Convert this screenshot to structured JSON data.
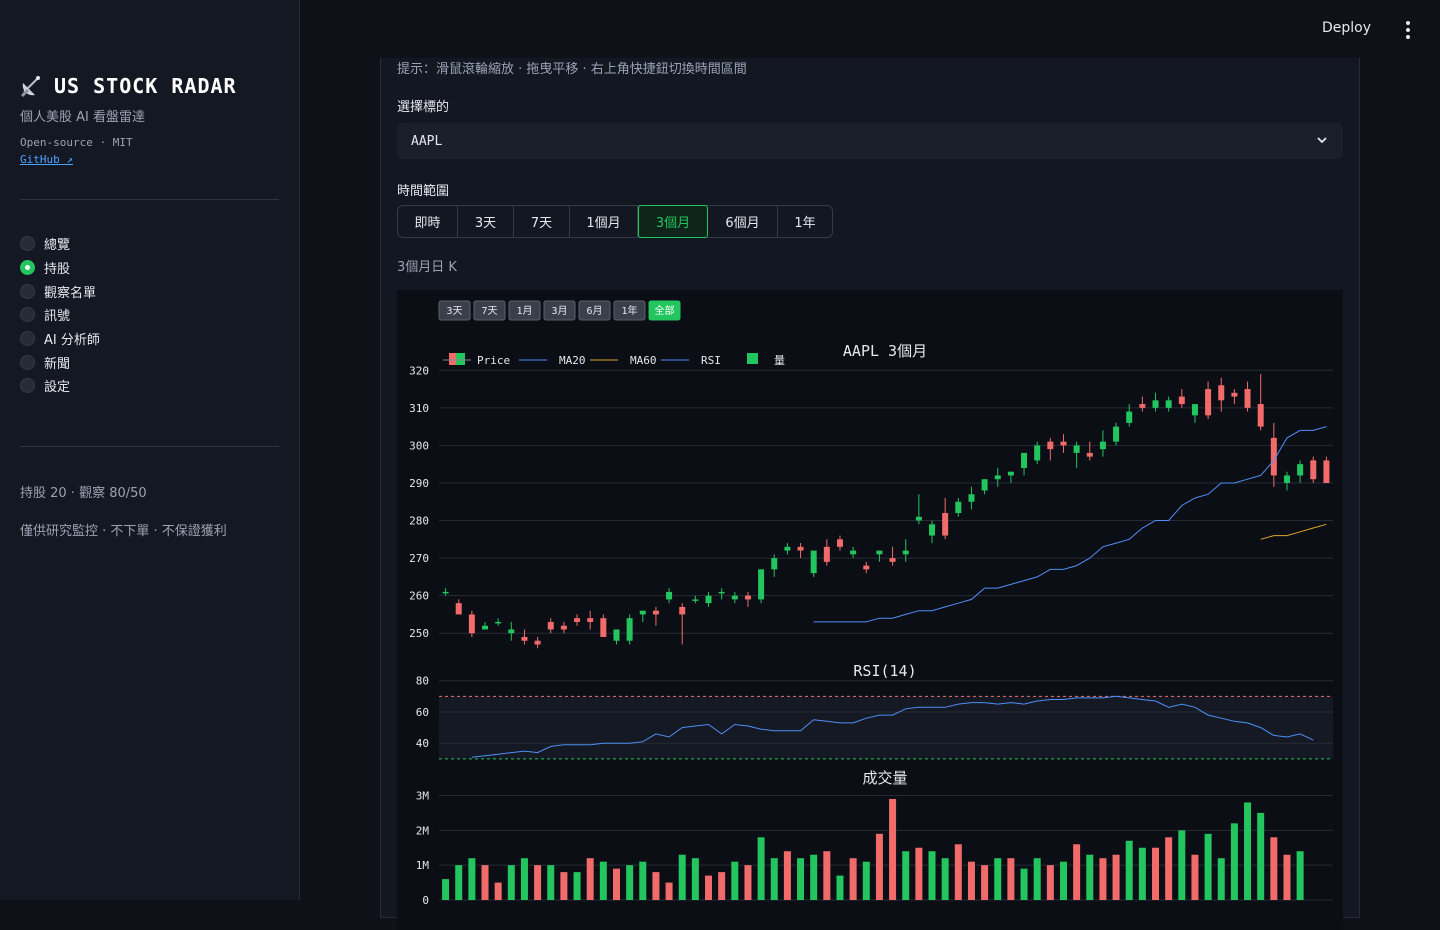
{
  "sidebar": {
    "title": "US STOCK RADAR",
    "subtitle": "個人美股 AI 看盤雷達",
    "meta": "Open-source · MIT",
    "github": "GitHub ↗",
    "nav": [
      {
        "label": "總覽",
        "selected": false
      },
      {
        "label": "持股",
        "selected": true
      },
      {
        "label": "觀察名單",
        "selected": false
      },
      {
        "label": "訊號",
        "selected": false
      },
      {
        "label": "AI 分析師",
        "selected": false
      },
      {
        "label": "新聞",
        "selected": false
      },
      {
        "label": "設定",
        "selected": false
      }
    ],
    "stats": "持股 20 · 觀察 80/50",
    "disclaimer": "僅供研究監控 · 不下單 · 不保證獲利"
  },
  "topbar": {
    "deploy": "Deploy"
  },
  "main": {
    "hint": "提示：滑鼠滾輪縮放 · 拖曳平移 · 右上角快捷鈕切換時間區間",
    "ticker_label": "選擇標的",
    "ticker_value": "AAPL",
    "range_label": "時間範圍",
    "ranges": [
      "即時",
      "3天",
      "7天",
      "1個月",
      "3個月",
      "6個月",
      "1年"
    ],
    "active_range": "3個月",
    "chart_caption": "3個月日 K"
  },
  "colors": {
    "up": "#22c55e",
    "down": "#f26b6b",
    "ma20": "#4f8ff7",
    "ma60": "#e0a526",
    "rsi": "#4f8ff7",
    "accent": "#22c55e"
  },
  "chart_data": {
    "type": "candlestick",
    "title": "AAPL 3個月",
    "rangeselector": [
      "3天",
      "7天",
      "1月",
      "3月",
      "6月",
      "1年",
      "全部"
    ],
    "rangeselector_active": "全部",
    "legend": [
      "Price",
      "MA20",
      "MA60",
      "RSI",
      "量"
    ],
    "legend_placement": "top-left",
    "price_yticks": [
      250,
      260,
      270,
      280,
      290,
      300,
      310,
      320
    ],
    "price_ylim": [
      245,
      323
    ],
    "candles": [
      [
        261,
        262,
        260,
        261
      ],
      [
        258,
        259,
        255,
        255
      ],
      [
        255,
        256,
        249,
        250
      ],
      [
        251,
        253,
        251,
        252
      ],
      [
        253,
        254,
        252,
        253
      ],
      [
        250,
        253,
        248,
        251
      ],
      [
        249,
        251,
        247,
        248
      ],
      [
        248,
        249,
        246,
        247
      ],
      [
        253,
        254,
        250,
        251
      ],
      [
        252,
        253,
        250,
        251
      ],
      [
        254,
        255,
        252,
        253
      ],
      [
        254,
        256,
        251,
        253
      ],
      [
        254,
        255,
        249,
        249
      ],
      [
        248,
        251,
        247,
        251
      ],
      [
        248,
        255,
        247,
        254
      ],
      [
        255,
        256,
        253,
        256
      ],
      [
        256,
        257,
        252,
        255
      ],
      [
        259,
        262,
        258,
        261
      ],
      [
        257,
        258,
        247,
        255
      ],
      [
        259,
        260,
        258,
        259
      ],
      [
        258,
        261,
        257,
        260
      ],
      [
        261,
        262,
        259,
        261
      ],
      [
        259,
        261,
        258,
        260
      ],
      [
        260,
        261,
        257,
        259
      ],
      [
        259,
        267,
        258,
        267
      ],
      [
        267,
        271,
        265,
        270
      ],
      [
        272,
        274,
        271,
        273
      ],
      [
        273,
        274,
        270,
        272
      ],
      [
        266,
        272,
        265,
        272
      ],
      [
        273,
        275,
        268,
        269
      ],
      [
        275,
        276,
        272,
        273
      ],
      [
        271,
        273,
        270,
        272
      ],
      [
        268,
        269,
        266,
        267
      ],
      [
        271,
        272,
        269,
        272
      ],
      [
        270,
        273,
        268,
        269
      ],
      [
        271,
        275,
        269,
        272
      ],
      [
        280,
        287,
        279,
        281
      ],
      [
        276,
        280,
        274,
        279
      ],
      [
        282,
        286,
        275,
        276
      ],
      [
        282,
        286,
        281,
        285
      ],
      [
        285,
        289,
        283,
        287
      ],
      [
        288,
        291,
        287,
        291
      ],
      [
        291,
        294,
        289,
        292
      ],
      [
        292,
        293,
        290,
        293
      ],
      [
        294,
        297,
        292,
        298
      ],
      [
        296,
        301,
        295,
        300
      ],
      [
        301,
        302,
        296,
        299
      ],
      [
        301,
        303,
        298,
        300
      ],
      [
        298,
        301,
        294,
        300
      ],
      [
        298,
        301,
        296,
        297
      ],
      [
        299,
        304,
        297,
        301
      ],
      [
        301,
        306,
        300,
        305
      ],
      [
        306,
        311,
        305,
        309
      ],
      [
        311,
        313,
        309,
        310
      ],
      [
        310,
        314,
        309,
        312
      ],
      [
        310,
        313,
        309,
        312
      ],
      [
        313,
        315,
        310,
        311
      ],
      [
        308,
        311,
        306,
        311
      ],
      [
        315,
        317,
        307,
        308
      ],
      [
        316,
        318,
        309,
        312
      ],
      [
        314,
        315,
        311,
        313
      ],
      [
        315,
        317,
        309,
        310
      ],
      [
        311,
        319,
        304,
        305
      ],
      [
        302,
        306,
        289,
        292
      ],
      [
        290,
        293,
        288,
        292
      ],
      [
        292,
        296,
        290,
        295
      ],
      [
        296,
        297,
        290,
        291
      ],
      [
        296,
        297,
        290,
        290
      ]
    ],
    "ma20": [
      253,
      253,
      253,
      253,
      253,
      254,
      254,
      255,
      256,
      256,
      257,
      258,
      259,
      262,
      262,
      263,
      264,
      265,
      267,
      267,
      268,
      270,
      273,
      274,
      275,
      278,
      280,
      280,
      284,
      286,
      287,
      290,
      290,
      291,
      292,
      296,
      302,
      304,
      304,
      305
    ],
    "ma60": [
      275,
      276,
      276,
      277,
      278,
      279
    ],
    "rsi_title": "RSI(14)",
    "rsi_yticks": [
      40,
      60,
      80
    ],
    "rsi_ylim": [
      28,
      83
    ],
    "rsi_overbought": 70,
    "rsi_oversold": 30,
    "rsi": [
      31,
      32,
      33,
      34,
      35,
      34,
      38,
      39,
      39,
      39,
      40,
      40,
      40,
      41,
      46,
      44,
      50,
      51,
      52,
      46,
      52,
      51,
      49,
      48,
      48,
      48,
      55,
      54,
      53,
      53,
      56,
      58,
      58,
      62,
      63,
      63,
      63,
      65,
      66,
      66,
      65,
      66,
      65,
      67,
      68,
      68,
      69,
      69,
      69,
      70,
      69,
      68,
      67,
      63,
      65,
      63,
      58,
      56,
      54,
      53,
      50,
      45,
      44,
      46,
      42
    ],
    "volume_title": "成交量",
    "volume_yticks": [
      "0",
      "1M",
      "2M",
      "3M"
    ],
    "volume_ylim": [
      0,
      3.1
    ],
    "volume": [
      0.6,
      1.0,
      1.2,
      1.0,
      0.5,
      1.0,
      1.2,
      1.0,
      1.0,
      0.8,
      0.8,
      1.2,
      1.1,
      0.9,
      1.0,
      1.1,
      0.8,
      0.5,
      1.3,
      1.2,
      0.7,
      0.8,
      1.1,
      1.0,
      1.8,
      1.2,
      1.4,
      1.2,
      1.3,
      1.4,
      0.7,
      1.2,
      1.1,
      1.9,
      2.9,
      1.4,
      1.5,
      1.4,
      1.2,
      1.6,
      1.1,
      1.0,
      1.2,
      1.2,
      0.9,
      1.2,
      1.0,
      1.1,
      1.6,
      1.3,
      1.2,
      1.3,
      1.7,
      1.5,
      1.5,
      1.8,
      2.0,
      1.3,
      1.9,
      1.2,
      2.2,
      2.8,
      2.5,
      1.8,
      1.3,
      1.4
    ],
    "volume_up": [
      1,
      1,
      1,
      0,
      0,
      1,
      1,
      0,
      1,
      0,
      1,
      0,
      1,
      0,
      1,
      1,
      0,
      0,
      1,
      1,
      0,
      0,
      1,
      0,
      1,
      1,
      0,
      1,
      1,
      0,
      1,
      0,
      1,
      0,
      0,
      1,
      0,
      1,
      1,
      0,
      0,
      0,
      1,
      0,
      1,
      1,
      0,
      1,
      0,
      1,
      0,
      0,
      1,
      1,
      0,
      0,
      1,
      0,
      1,
      1,
      1,
      1,
      1,
      0,
      0,
      1
    ]
  }
}
